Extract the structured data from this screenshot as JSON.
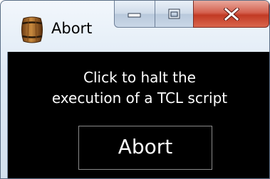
{
  "window": {
    "title": "Abort",
    "icon": "barrel-icon",
    "caption_buttons": [
      "minimize-icon",
      "maximize-icon",
      "close-icon"
    ]
  },
  "content": {
    "message_line1": "Click to halt the",
    "message_line2": "execution of a TCL script",
    "button_label": "Abort"
  },
  "colors": {
    "client_background": "#000000",
    "text": "#ffffff",
    "close_button": "#c8452f",
    "button_border": "#8a8a8a"
  }
}
